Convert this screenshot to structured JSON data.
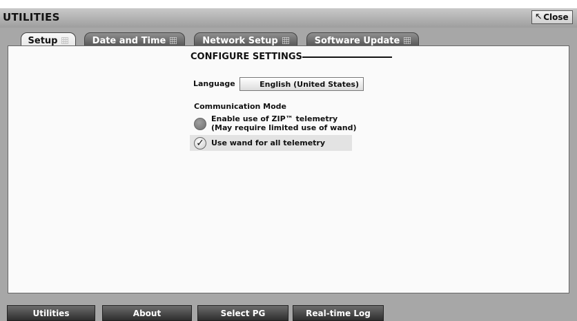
{
  "titlebar": {
    "title": "UTILITIES",
    "close_label": "Close",
    "close_icon": "cursor-arrow-icon"
  },
  "tabs": [
    {
      "label": "Setup",
      "active": true
    },
    {
      "label": "Date and Time",
      "active": false
    },
    {
      "label": "Network Setup",
      "active": false
    },
    {
      "label": "Software Update",
      "active": false
    }
  ],
  "configure": {
    "title": "CONFIGURE SETTINGS",
    "language_label": "Language",
    "language_value": "English (United States)",
    "comm_label": "Communication Mode",
    "options": [
      {
        "line1": "Enable use of ZIP™ telemetry",
        "line2": "(May require limited use of wand)",
        "selected": false
      },
      {
        "line1": "Use wand for all telemetry",
        "selected": true
      }
    ],
    "check_glyph": "✓"
  },
  "bottom_nav": [
    {
      "label": "Utilities"
    },
    {
      "label": "About"
    },
    {
      "label": "Select PG"
    },
    {
      "label": "Real-time Log"
    }
  ]
}
